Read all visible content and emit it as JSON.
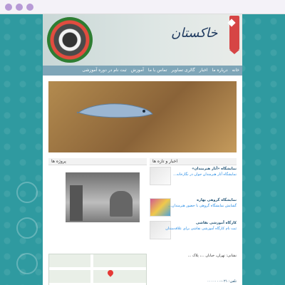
{
  "browser": {
    "window_controls": [
      "dot",
      "dot",
      "dot"
    ]
  },
  "header": {
    "logo_text": "خاکستان",
    "accent_color": "#d64545"
  },
  "nav": {
    "items": [
      {
        "label": "خانه"
      },
      {
        "label": "درباره ما"
      },
      {
        "label": "اخبار"
      },
      {
        "label": "گالری تصاویر"
      },
      {
        "label": "تماس با ما"
      },
      {
        "label": "آموزش"
      },
      {
        "label": "ثبت نام در دوره آموزشی"
      }
    ]
  },
  "panels": {
    "left_title": "پروژه ها",
    "right_title": "اخبار و تازه ها"
  },
  "news": {
    "items": [
      {
        "title": "نمایشگاه «آثار هنرمندان»",
        "desc": "نمایشگاه آثار هنرمندان جوان در نگارخانه..."
      },
      {
        "title": "نمایشگاه گروهی بهاره",
        "desc": "گشایش نمایشگاه گروهی با حضور هنرمندان..."
      },
      {
        "title": "کارگاه آموزشی نقاشی",
        "desc": "ثبت نام کارگاه آموزشی نقاشی برای علاقه‌مندان"
      }
    ]
  },
  "footer": {
    "address": "نشانی: تهران، خیابان ...، پلاک ...",
    "phones": "تلفن: ۰۲۱-۰۰۰۰۰۰۰"
  }
}
